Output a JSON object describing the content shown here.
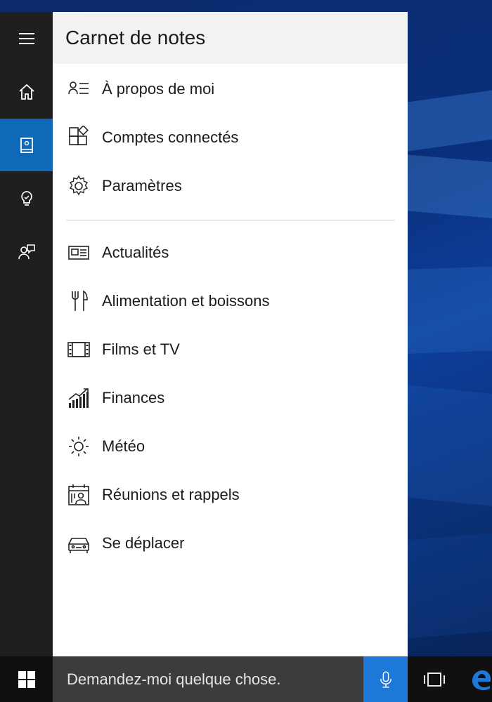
{
  "panel": {
    "title": "Carnet de notes"
  },
  "rail": {
    "items": [
      {
        "icon": "hamburger-icon"
      },
      {
        "icon": "home-icon"
      },
      {
        "icon": "notebook-icon",
        "active": true
      },
      {
        "icon": "lightbulb-icon"
      },
      {
        "icon": "feedback-icon"
      }
    ]
  },
  "notebook": {
    "top_items": [
      {
        "label": "À propos de moi",
        "icon": "profile-list-icon"
      },
      {
        "label": "Comptes connectés",
        "icon": "connected-accounts-icon"
      },
      {
        "label": "Paramètres",
        "icon": "gear-icon"
      }
    ],
    "items": [
      {
        "label": "Actualités",
        "icon": "news-icon"
      },
      {
        "label": "Alimentation et boissons",
        "icon": "cutlery-icon"
      },
      {
        "label": "Films et TV",
        "icon": "film-icon"
      },
      {
        "label": "Finances",
        "icon": "finance-chart-icon"
      },
      {
        "label": "Météo",
        "icon": "sun-icon"
      },
      {
        "label": "Réunions et rappels",
        "icon": "calendar-person-icon"
      },
      {
        "label": "Se déplacer",
        "icon": "car-icon"
      }
    ]
  },
  "taskbar": {
    "search_placeholder": "Demandez-moi quelque chose.",
    "accent_color": "#1e78d7"
  }
}
